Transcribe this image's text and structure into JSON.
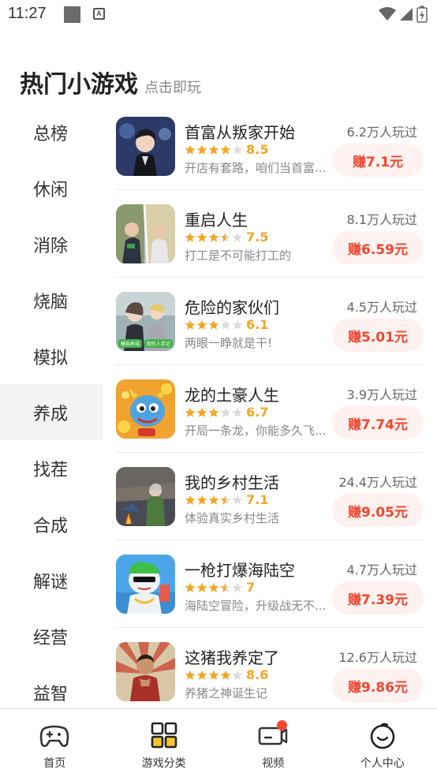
{
  "status": {
    "time": "11:27",
    "a_icon": "A"
  },
  "header": {
    "title": "热门小游戏",
    "subtitle": "点击即玩"
  },
  "categories": [
    {
      "label": "总榜",
      "active": false
    },
    {
      "label": "休闲",
      "active": false
    },
    {
      "label": "消除",
      "active": false
    },
    {
      "label": "烧脑",
      "active": false
    },
    {
      "label": "模拟",
      "active": false
    },
    {
      "label": "养成",
      "active": true
    },
    {
      "label": "找茬",
      "active": false
    },
    {
      "label": "合成",
      "active": false
    },
    {
      "label": "解谜",
      "active": false
    },
    {
      "label": "经营",
      "active": false
    },
    {
      "label": "益智",
      "active": false
    }
  ],
  "games": [
    {
      "name": "首富从叛家开始",
      "score": "8.5",
      "stars": 4,
      "desc": "开店有套路，咱们当首富...",
      "players": "6.2万人玩过",
      "earn": "赚7.1元"
    },
    {
      "name": "重启人生",
      "score": "7.5",
      "stars": 3.5,
      "desc": "打工是不可能打工的",
      "players": "8.1万人玩过",
      "earn": "赚6.59元"
    },
    {
      "name": "危险的家伙们",
      "score": "6.1",
      "stars": 3,
      "desc": "两眼一睁就是干!",
      "players": "4.5万人玩过",
      "earn": "赚5.01元"
    },
    {
      "name": "龙的土豪人生",
      "score": "6.7",
      "stars": 3,
      "desc": "开局一条龙，你能多久飞...",
      "players": "3.9万人玩过",
      "earn": "赚7.74元"
    },
    {
      "name": "我的乡村生活",
      "score": "7.1",
      "stars": 3.5,
      "desc": "体验真实乡村生活",
      "players": "24.4万人玩过",
      "earn": "赚9.05元"
    },
    {
      "name": "一枪打爆海陆空",
      "score": "7",
      "stars": 3.5,
      "desc": "海陆空冒险，升级战无不...",
      "players": "4.7万人玩过",
      "earn": "赚7.39元"
    },
    {
      "name": "这猪我养定了",
      "score": "8.6",
      "stars": 4,
      "desc": "养猪之神诞生记",
      "players": "12.6万人玩过",
      "earn": "赚9.86元"
    }
  ],
  "thumb_tags": {
    "left": "模拟养成",
    "right": "制作人手记"
  },
  "bottom_nav": [
    {
      "label": "首页",
      "icon": "gamepad-icon"
    },
    {
      "label": "游戏分类",
      "icon": "grid-icon"
    },
    {
      "label": "视频",
      "icon": "video-icon"
    },
    {
      "label": "个人中心",
      "icon": "smile-face-icon"
    }
  ],
  "colors": {
    "accent": "#f2462f",
    "star": "#f6a623",
    "star_empty": "#dddddd",
    "nav_yellow": "#f6c428"
  }
}
